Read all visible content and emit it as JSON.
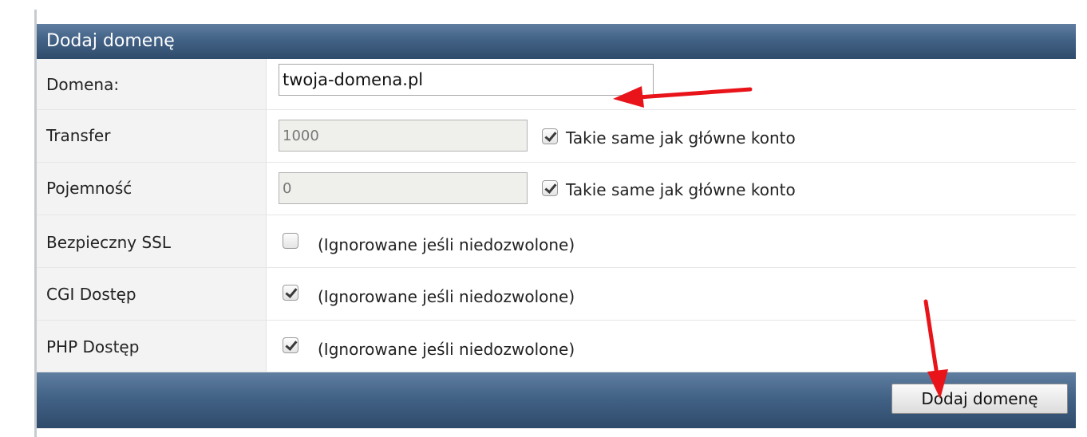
{
  "panel": {
    "title": "Dodaj domenę"
  },
  "form": {
    "domain": {
      "label": "Domena:",
      "value": "twoja-domena.pl"
    },
    "transfer": {
      "label": "Transfer",
      "value": "1000",
      "same_as_main_label": "Takie same jak główne konto",
      "same_as_main_checked": true
    },
    "capacity": {
      "label": "Pojemność",
      "value": "0",
      "same_as_main_label": "Takie same jak główne konto",
      "same_as_main_checked": true
    },
    "ssl": {
      "label": "Bezpieczny SSL",
      "note": "(Ignorowane jeśli niedozwolone)",
      "checked": false
    },
    "cgi": {
      "label": "CGI Dostęp",
      "note": "(Ignorowane jeśli niedozwolone)",
      "checked": true
    },
    "php": {
      "label": "PHP Dostęp",
      "note": "(Ignorowane jeśli niedozwolone)",
      "checked": true
    }
  },
  "footer": {
    "submit_label": "Dodaj domenę"
  },
  "colors": {
    "header_bg": "#426286",
    "annotation_arrow": "#e8141a"
  }
}
